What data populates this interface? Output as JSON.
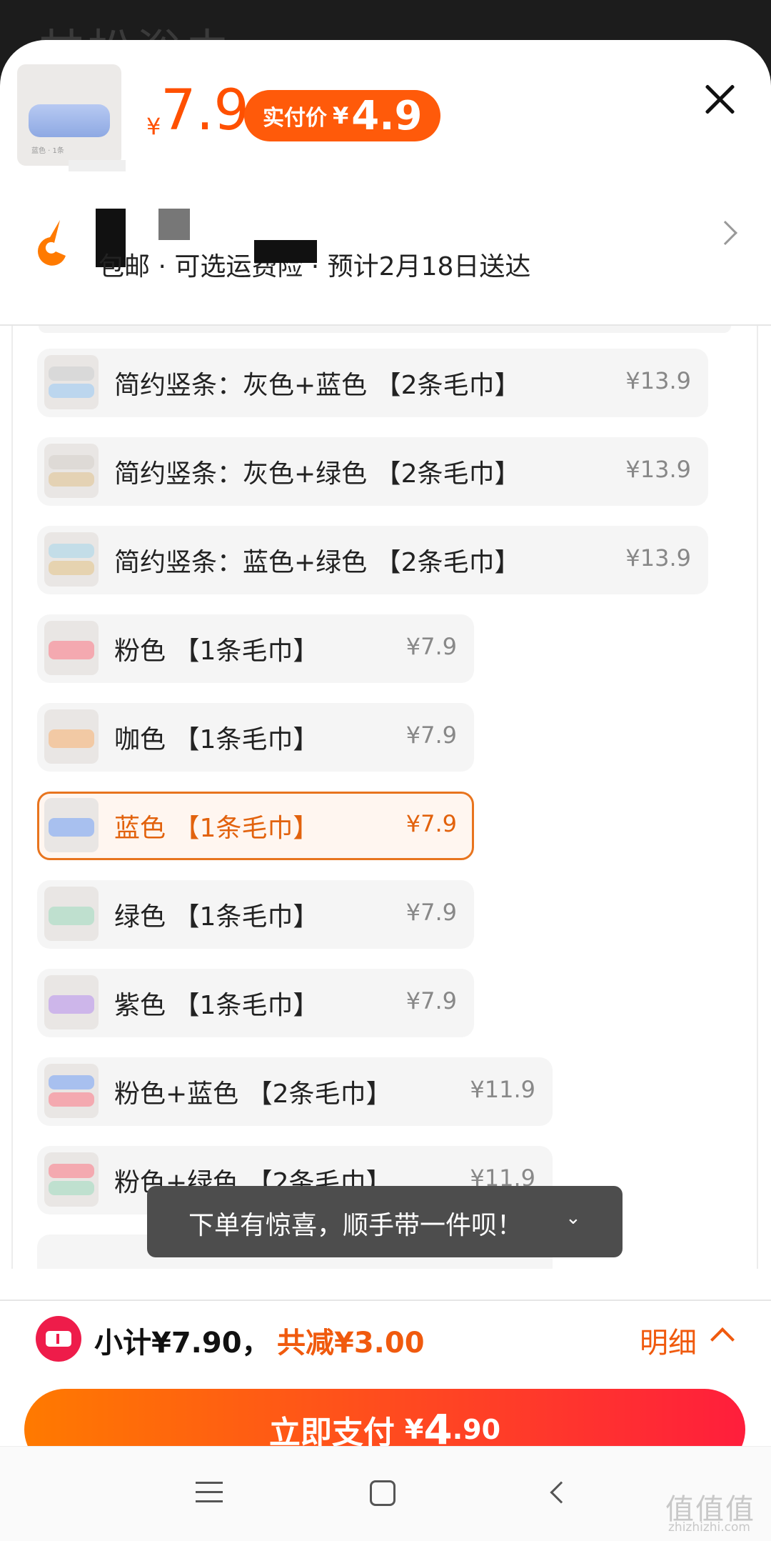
{
  "background": {
    "title": "甘松浴巾"
  },
  "header": {
    "currency_small": "¥",
    "price": "7.9",
    "pay_label": "实付价",
    "pay_currency": "¥",
    "pay_value": "4.9",
    "product_thumb_caption": "蓝色 · 1条"
  },
  "shipping": {
    "text": "包邮 · 可选运费险 · 预计2月18日送达"
  },
  "options": [
    {
      "label": "简约竖条：灰色+蓝色 【2条毛巾】",
      "price": "¥13.9"
    },
    {
      "label": "简约竖条：灰色+绿色 【2条毛巾】",
      "price": "¥13.9"
    },
    {
      "label": "简约竖条：蓝色+绿色 【2条毛巾】",
      "price": "¥13.9"
    },
    {
      "label": "粉色 【1条毛巾】",
      "price": "¥7.9"
    },
    {
      "label": "咖色 【1条毛巾】",
      "price": "¥7.9"
    },
    {
      "label": "蓝色 【1条毛巾】",
      "price": "¥7.9",
      "selected": true
    },
    {
      "label": "绿色 【1条毛巾】",
      "price": "¥7.9"
    },
    {
      "label": "紫色 【1条毛巾】",
      "price": "¥7.9"
    },
    {
      "label": "粉色+蓝色 【2条毛巾】",
      "price": "¥11.9"
    },
    {
      "label": "粉色+绿色 【2条毛巾】",
      "price": "¥11.9"
    }
  ],
  "toast": {
    "text": "下单有惊喜，顺手带一件呗！",
    "icon": "double-chevron-down-icon"
  },
  "summary": {
    "subtotal": "小计¥7.90，",
    "reduce": "共减¥3.00",
    "detail": "明细"
  },
  "pay_button": {
    "label": "立即支付",
    "currency": "¥",
    "int": "4",
    "dec": ".90"
  },
  "watermark": {
    "main": "值值值",
    "sub": "zhizhizhi.com"
  },
  "colors": {
    "accent": "#ff5000",
    "selected_border": "#e8741e",
    "coupon": "#ee1c4a"
  }
}
